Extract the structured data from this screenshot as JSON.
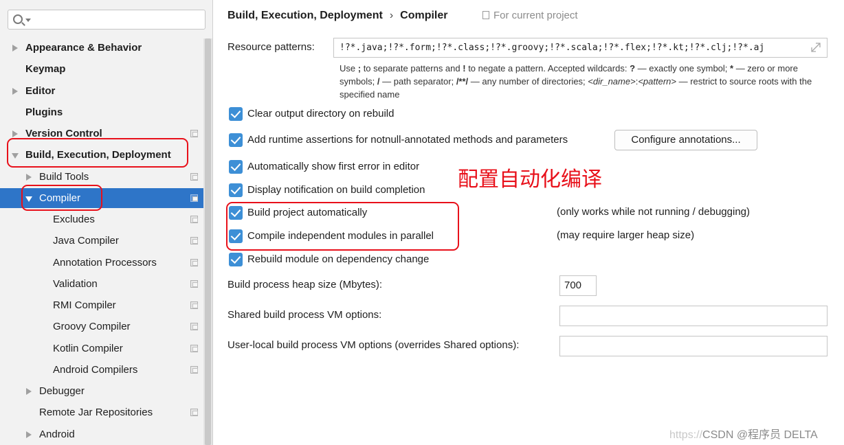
{
  "search": {
    "placeholder": ""
  },
  "sidebar": {
    "items": [
      {
        "label": "Appearance & Behavior"
      },
      {
        "label": "Keymap"
      },
      {
        "label": "Editor"
      },
      {
        "label": "Plugins"
      },
      {
        "label": "Version Control"
      },
      {
        "label": "Build, Execution, Deployment"
      },
      {
        "label": "Build Tools"
      },
      {
        "label": "Compiler"
      },
      {
        "label": "Excludes"
      },
      {
        "label": "Java Compiler"
      },
      {
        "label": "Annotation Processors"
      },
      {
        "label": "Validation"
      },
      {
        "label": "RMI Compiler"
      },
      {
        "label": "Groovy Compiler"
      },
      {
        "label": "Kotlin Compiler"
      },
      {
        "label": "Android Compilers"
      },
      {
        "label": "Debugger"
      },
      {
        "label": "Remote Jar Repositories"
      },
      {
        "label": "Android"
      }
    ],
    "selected": "Compiler"
  },
  "breadcrumb": {
    "parent": "Build, Execution, Deployment",
    "separator": "›",
    "current": "Compiler"
  },
  "scope_note": "For current project",
  "resource_patterns": {
    "label": "Resource patterns:",
    "value": "!?*.java;!?*.form;!?*.class;!?*.groovy;!?*.scala;!?*.flex;!?*.kt;!?*.clj;!?*.aj",
    "hint": {
      "p1": "Use ",
      "b1": ";",
      "p2": " to separate patterns and ",
      "b2": "!",
      "p3": " to negate a pattern. Accepted wildcards: ",
      "b3": "?",
      "p4": " — exactly one symbol; ",
      "b4": "*",
      "p5": " — zero or more symbols; ",
      "b5": "/",
      "p6": " — path separator; ",
      "b6": "/**/",
      "p7": " — any number of directories; ",
      "i1": "<dir_name>",
      "p8": ":",
      "i2": "<pattern>",
      "p9": " — restrict to source roots with the specified name"
    }
  },
  "options": {
    "clear_output": {
      "label": "Clear output directory on rebuild",
      "checked": true
    },
    "runtime_assertions": {
      "label": "Add runtime assertions for notnull-annotated methods and parameters",
      "checked": true
    },
    "configure_button": "Configure annotations...",
    "show_first_error": {
      "label": "Automatically show first error in editor",
      "checked": true
    },
    "display_notification": {
      "label": "Display notification on build completion",
      "checked": true
    },
    "build_automatically": {
      "label": "Build project automatically",
      "checked": true,
      "note": "(only works while not running / debugging)"
    },
    "compile_parallel": {
      "label": "Compile independent modules in parallel",
      "checked": true,
      "note": "(may require larger heap size)"
    },
    "rebuild_on_dependency": {
      "label": "Rebuild module on dependency change",
      "checked": true
    }
  },
  "heap_size": {
    "label": "Build process heap size (Mbytes):",
    "value": "700"
  },
  "shared_vm": {
    "label": "Shared build process VM options:",
    "value": ""
  },
  "user_vm": {
    "label": "User-local build process VM options (overrides Shared options):",
    "value": ""
  },
  "annotation": {
    "text": "配置自动化编译"
  },
  "watermark": {
    "url": "https://",
    "csdn": "CSDN @程序员 DELTA",
    "color": "#c8c8c8"
  },
  "colors": {
    "selection": "#2e75c8",
    "checkbox": "#3d8fd6",
    "highlight": "#e8101a"
  }
}
